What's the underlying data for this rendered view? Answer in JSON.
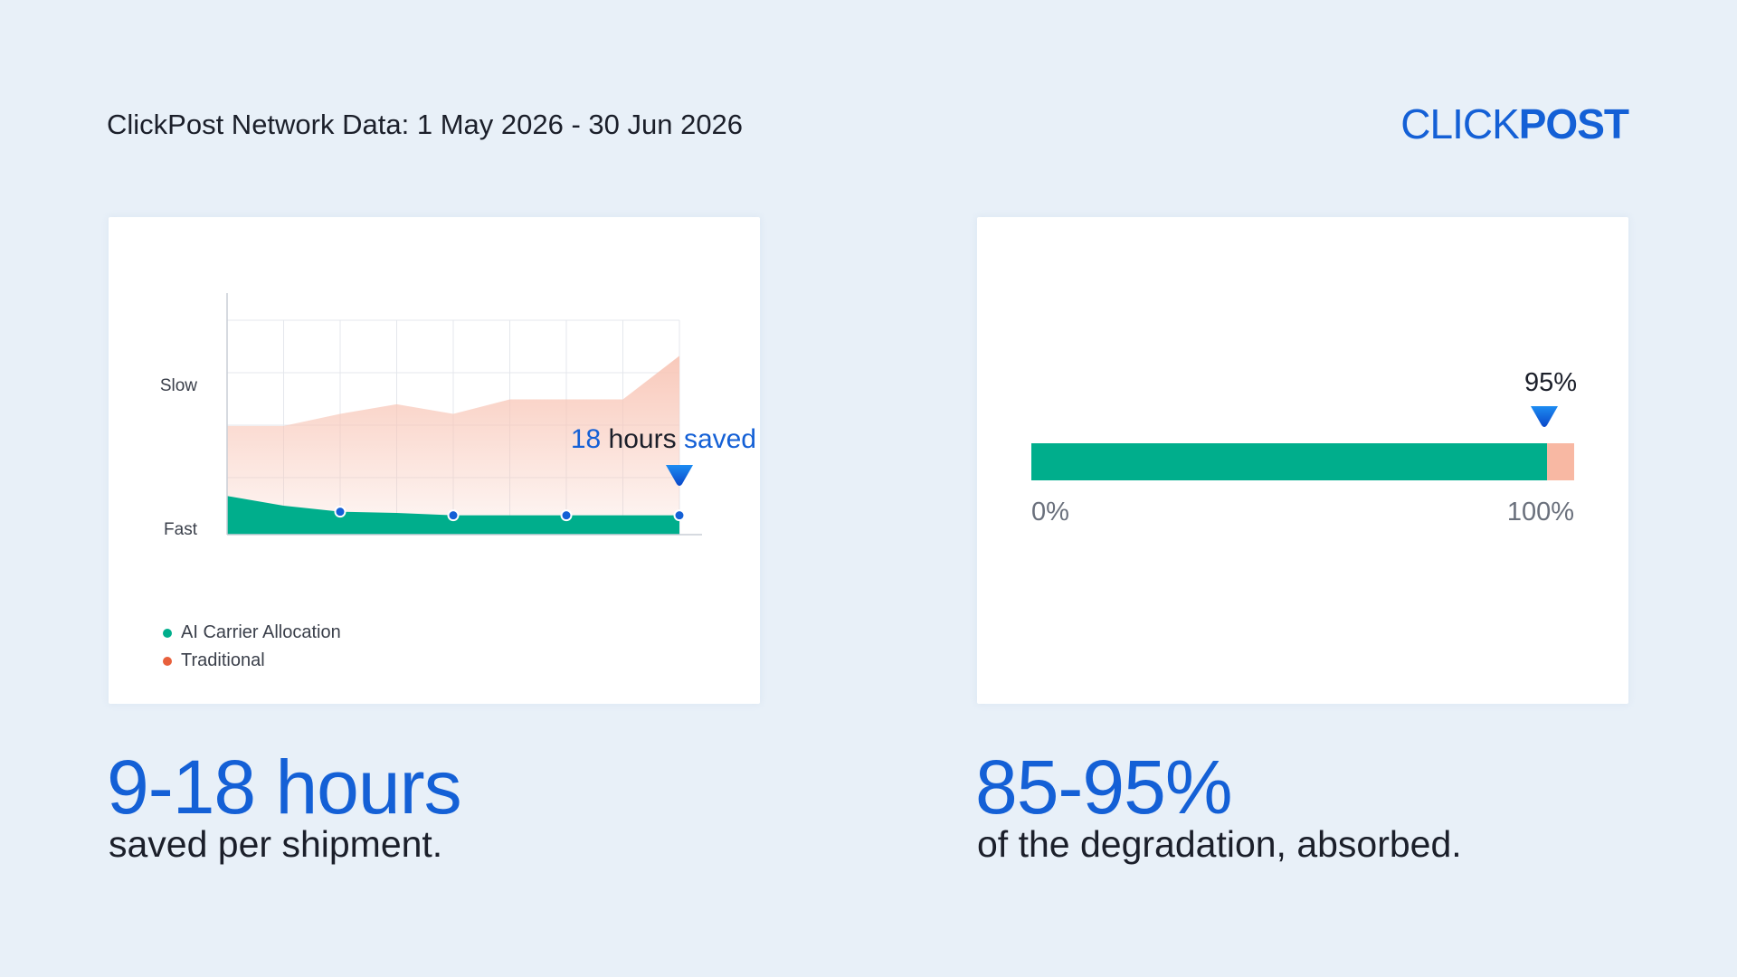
{
  "header": {
    "lead": "ClickPost Network Data:",
    "date_range": "1 May 2026 - 30 Jun 2026"
  },
  "logo": {
    "light": "CLICK",
    "bold": "POST"
  },
  "colors": {
    "brand_blue": "#1460d6",
    "ai_green": "#00ae8c",
    "traditional_orange": "#e8603c",
    "traditional_fill": "#f8c6b7",
    "progress_remainder": "#f8b8a3"
  },
  "chart_data": [
    {
      "type": "area",
      "title": "",
      "xlabel": "",
      "ylabel": "",
      "y_axis_labels": [
        "Slow",
        "Fast"
      ],
      "grid": true,
      "legend_position": "bottom-left",
      "x": [
        0,
        1,
        2,
        3,
        4,
        5,
        6,
        7,
        8
      ],
      "ylim": [
        0,
        10
      ],
      "series": [
        {
          "name": "Traditional",
          "color": "#e8603c",
          "values": [
            4.5,
            4.5,
            5.0,
            5.4,
            5.0,
            5.6,
            5.6,
            5.6,
            7.4
          ]
        },
        {
          "name": "AI Carrier Allocation",
          "color": "#00ae8c",
          "values": [
            1.6,
            1.2,
            0.95,
            0.9,
            0.8,
            0.8,
            0.8,
            0.8,
            0.8
          ],
          "markers_at": [
            2,
            4,
            6,
            8
          ]
        }
      ],
      "annotation": {
        "at_x": 8,
        "value": "18",
        "unit": "hours",
        "suffix": "saved"
      }
    },
    {
      "type": "bar",
      "orientation": "horizontal",
      "value": 95,
      "range": [
        0,
        100
      ],
      "tick_labels": [
        "0%",
        "100%"
      ],
      "marker_label": "95%"
    }
  ],
  "stats": [
    {
      "value": "9-18 hours",
      "caption": "saved per shipment."
    },
    {
      "value": "85-95%",
      "caption": "of the degradation, absorbed."
    }
  ]
}
